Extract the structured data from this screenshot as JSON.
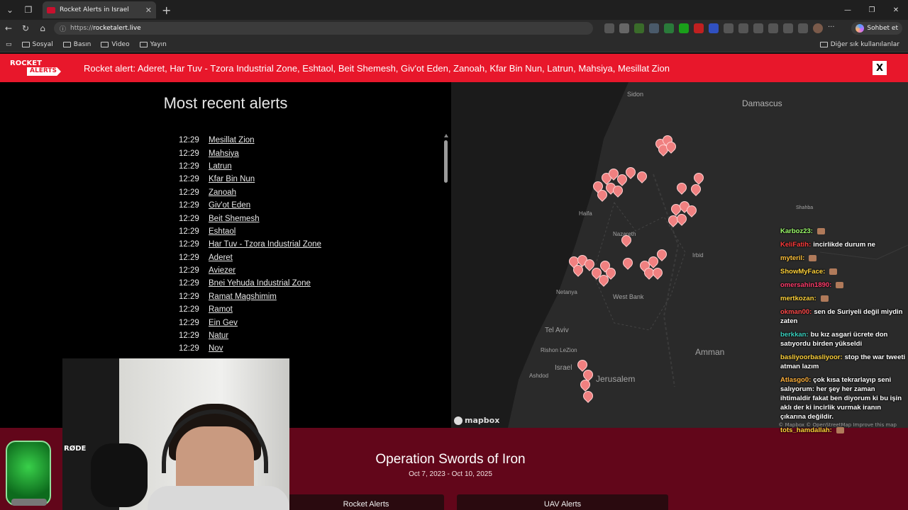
{
  "browser": {
    "tab_title": "Rocket Alerts in Israel",
    "url_scheme": "https://",
    "url_host": "rocketalert.live",
    "copilot_label": "Sohbet et",
    "bookmarks": [
      "Sosyal",
      "Basın",
      "Video",
      "Yayın"
    ],
    "bookmarks_right": "Diğer sık kullanılanlar"
  },
  "banner": {
    "logo_line1": "ROCKET",
    "logo_line2": "ALERTS",
    "text": "Rocket alert: Aderet, Har Tuv - Tzora Industrial Zone, Eshtaol, Beit Shemesh, Giv'ot Eden, Zanoah, Kfar Bin Nun, Latrun, Mahsiya, Mesillat Zion",
    "close_label": "X"
  },
  "recent": {
    "title": "Most recent alerts",
    "alerts": [
      {
        "time": "12:29",
        "city": "Mesillat Zion"
      },
      {
        "time": "12:29",
        "city": "Mahsiya"
      },
      {
        "time": "12:29",
        "city": "Latrun"
      },
      {
        "time": "12:29",
        "city": "Kfar Bin Nun"
      },
      {
        "time": "12:29",
        "city": "Zanoah"
      },
      {
        "time": "12:29",
        "city": "Giv'ot Eden"
      },
      {
        "time": "12:29",
        "city": "Beit Shemesh"
      },
      {
        "time": "12:29",
        "city": "Eshtaol"
      },
      {
        "time": "12:29",
        "city": "Har Tuv - Tzora Industrial Zone"
      },
      {
        "time": "12:29",
        "city": "Aderet"
      },
      {
        "time": "12:29",
        "city": "Aviezer"
      },
      {
        "time": "12:29",
        "city": "Bnei Yehuda Industrial Zone"
      },
      {
        "time": "12:29",
        "city": "Ramat Magshimim"
      },
      {
        "time": "12:29",
        "city": "Ramot"
      },
      {
        "time": "12:29",
        "city": "Ein Gev"
      },
      {
        "time": "12:29",
        "city": "Natur"
      },
      {
        "time": "12:29",
        "city": "Nov"
      }
    ]
  },
  "map": {
    "labels": {
      "sidon": "Sidon",
      "damascus": "Damascus",
      "haifa": "Haifa",
      "nazareth": "Nazareth",
      "netanya": "Netanya",
      "west_bank": "West Bank",
      "tel_aviv": "Tel Aviv",
      "rishon": "Rishon LeZion",
      "ashdod": "Ashdod",
      "israel": "Israel",
      "jerusalem": "Jerusalem",
      "amman": "Amman",
      "irbid": "Irbid",
      "shahba": "Shahba"
    },
    "brand": "mapbox",
    "attribution": "© Mapbox © OpenStreetMap  Improve this map"
  },
  "operation": {
    "title": "Operation Swords of Iron",
    "dates": "Oct 7, 2023 - Oct 10, 2025",
    "tabs": [
      "Rocket Alerts",
      "UAV Alerts"
    ]
  },
  "chat": [
    {
      "user": "Karboz23:",
      "text": "",
      "color": "#9dff6a"
    },
    {
      "user": "KeliFatih:",
      "text": "incirlikde durum ne",
      "color": "#ff3b3b"
    },
    {
      "user": "myteril:",
      "text": "",
      "color": "#ffc23a"
    },
    {
      "user": "ShowMyFace:",
      "text": "",
      "color": "#ffd23a"
    },
    {
      "user": "omersahin1890:",
      "text": "",
      "color": "#ff3b6a"
    },
    {
      "user": "mertkozan:",
      "text": "",
      "color": "#ffd23a"
    },
    {
      "user": "okman00:",
      "text": "sen de Suriyeli değil miydin zaten",
      "color": "#ff4a4a"
    },
    {
      "user": "berkkan:",
      "text": "bu kız asgari ücrete don satıyordu birden yükseldi",
      "color": "#3ad2c0"
    },
    {
      "user": "basliyoorbasliyoor:",
      "text": "stop the war tweeti atman lazım",
      "color": "#ffd23a"
    },
    {
      "user": "Atlasgo0:",
      "text": "çok kısa tekrarlayıp seni salıyorum: her şey her zaman ihtimaldir fakat ben diyorum ki bu işin aklı der ki incirlik vurmak iranın çıkarına değildir.",
      "color": "#ffb03a"
    },
    {
      "user": "tots_hamdallah:",
      "text": "",
      "color": "#ffd23a"
    }
  ],
  "cam": {
    "mic_brand": "RØDE"
  }
}
